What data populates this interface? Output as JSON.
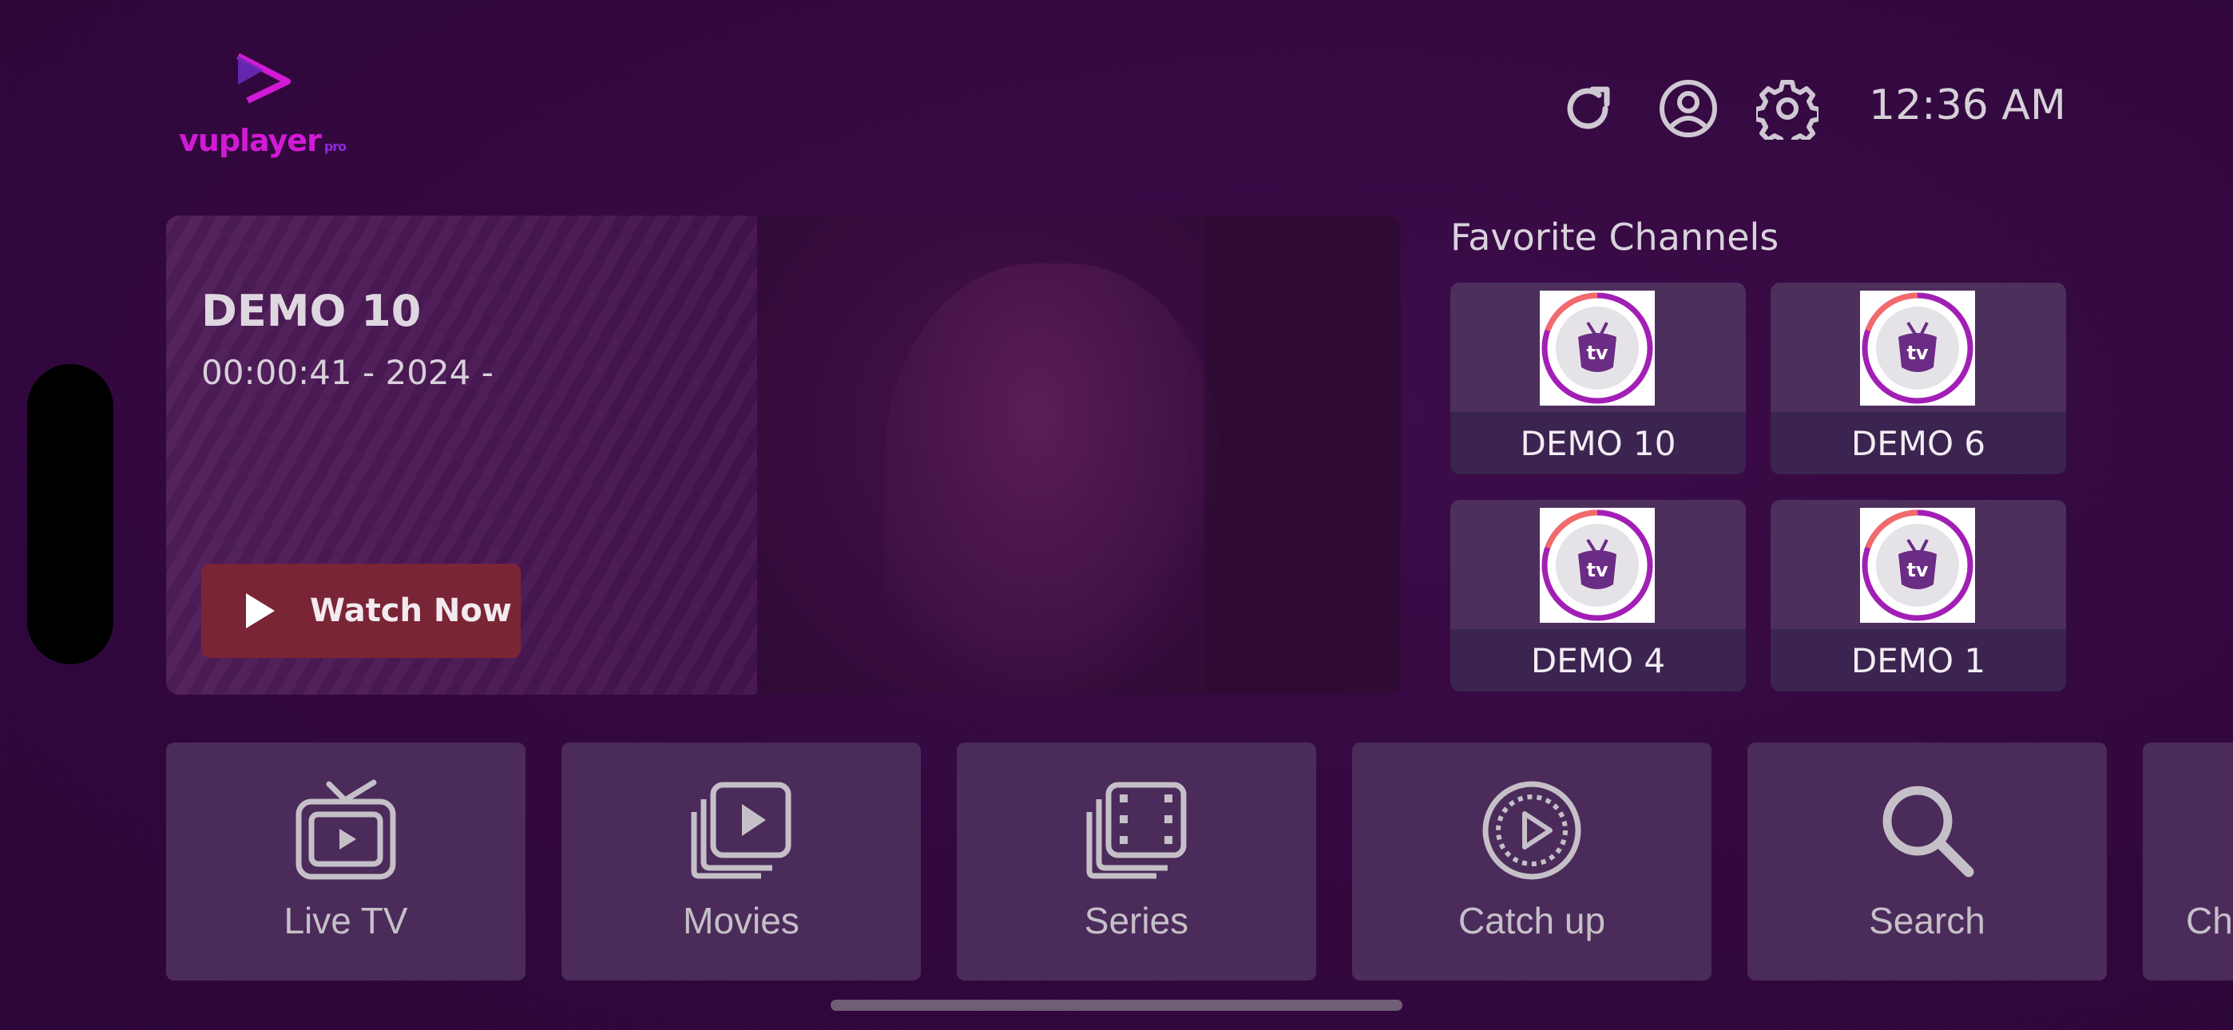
{
  "app": {
    "logo_text": "vuplayer",
    "logo_sub": "pro",
    "brand_color": "#d21ad6"
  },
  "header": {
    "icons": [
      "refresh-icon",
      "account-icon",
      "settings-icon"
    ],
    "time": "12:36 AM"
  },
  "hero": {
    "title": "DEMO 10",
    "subtitle": "00:00:41 - 2024 -",
    "watch_label": "Watch Now",
    "watch_color": "#7a2535"
  },
  "favorites": {
    "title": "Favorite Channels",
    "channels": [
      {
        "name": "DEMO 10"
      },
      {
        "name": "DEMO 6"
      },
      {
        "name": "DEMO 4"
      },
      {
        "name": "DEMO 1"
      }
    ]
  },
  "menu": {
    "items": [
      {
        "label": "Live TV",
        "icon": "tv-icon"
      },
      {
        "label": "Movies",
        "icon": "movies-icon"
      },
      {
        "label": "Series",
        "icon": "series-icon"
      },
      {
        "label": "Catch up",
        "icon": "catch-up-icon"
      },
      {
        "label": "Search",
        "icon": "search-icon"
      },
      {
        "label": "Ch",
        "icon": ""
      }
    ]
  }
}
